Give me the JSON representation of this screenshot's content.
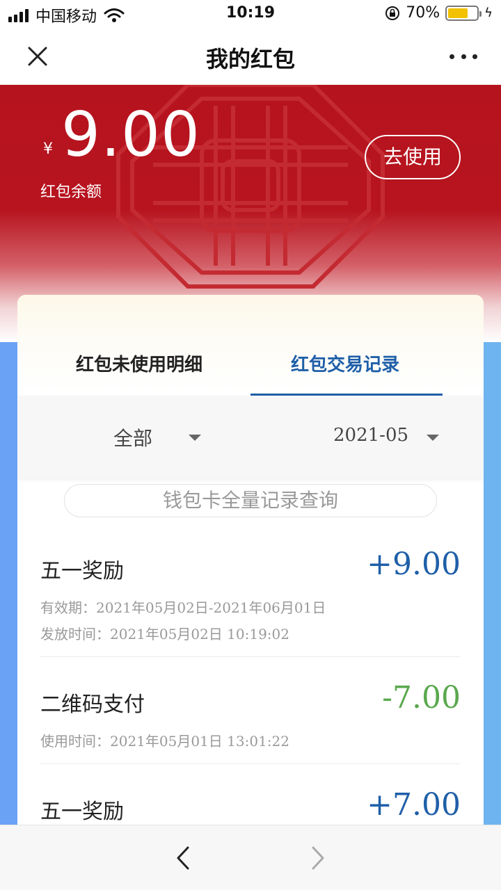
{
  "status": {
    "carrier": "中国移动",
    "time": "10:19",
    "battery_pct": "70%",
    "battery_level": 0.7,
    "battery_color": "#f2c100"
  },
  "nav": {
    "title": "我的红包",
    "close_icon": "close-icon",
    "more_icon": "more-icon"
  },
  "header": {
    "currency": "¥",
    "balance": "9.00",
    "balance_label": "红包余额",
    "use_button": "去使用",
    "bg_color": "#b5131e"
  },
  "tabs": [
    {
      "label": "红包未使用明细",
      "active": false
    },
    {
      "label": "红包交易记录",
      "active": true
    }
  ],
  "filters": {
    "type": "全部",
    "month": "2021-05"
  },
  "query_button": "钱包卡全量记录查询",
  "records": [
    {
      "title": "五一奖励",
      "amount": "+9.00",
      "meta": [
        "有效期：2021年05月02日-2021年06月01日",
        "发放时间：2021年05月02日 10:19:02"
      ]
    },
    {
      "title": "二维码支付",
      "amount": "-7.00",
      "meta": [
        "使用时间：2021年05月01日 13:01:22"
      ]
    },
    {
      "title": "五一奖励",
      "amount": "+7.00",
      "meta": []
    }
  ],
  "colors": {
    "accent_blue": "#1f5fa8",
    "positive": "#1f5fa8",
    "negative": "#5aa84e"
  }
}
